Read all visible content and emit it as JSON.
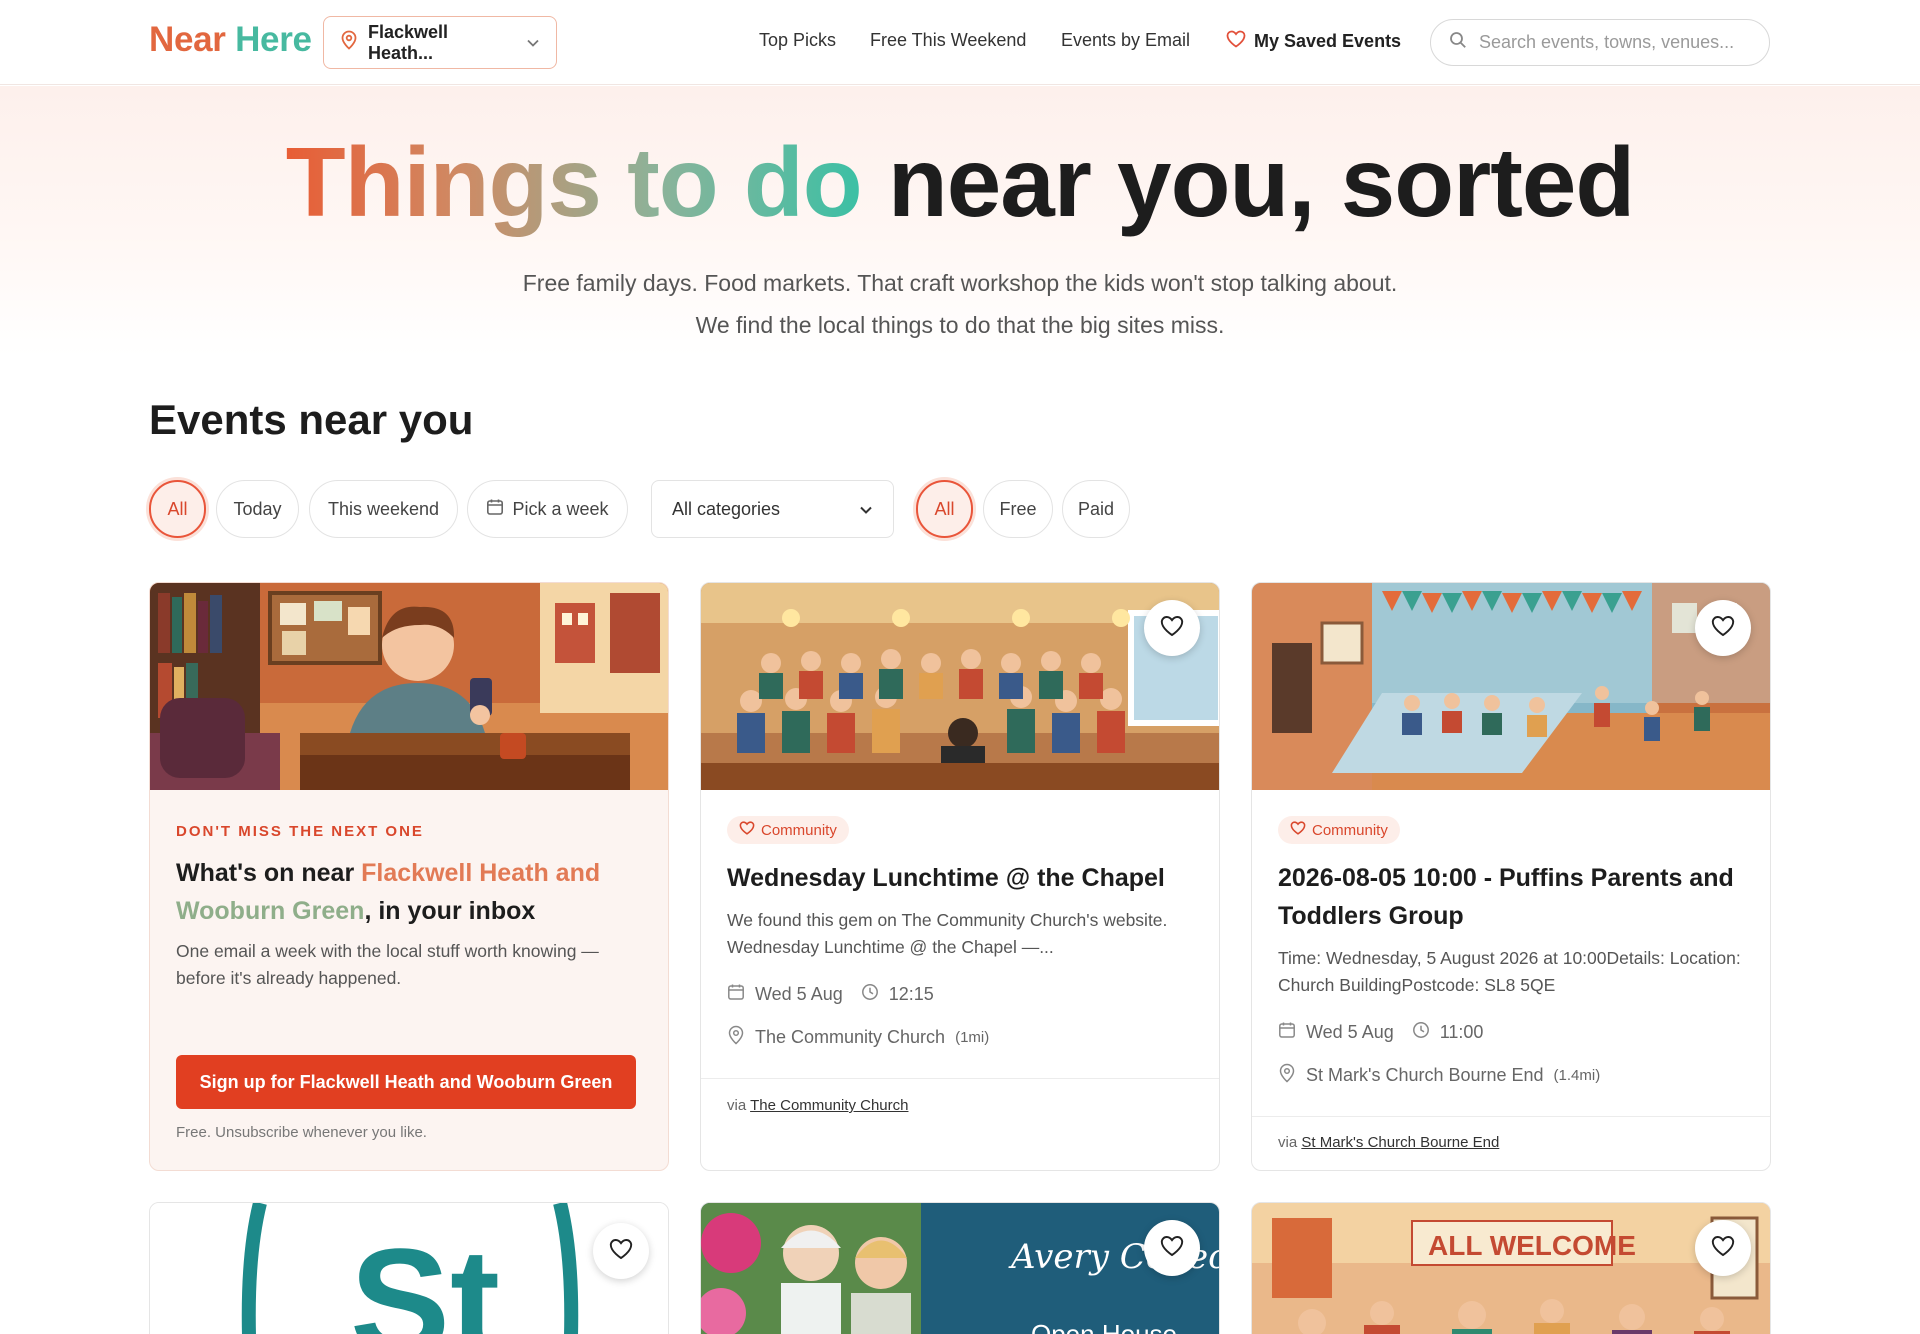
{
  "header": {
    "logo_near": "Near",
    "logo_here": "Here",
    "location": "Flackwell Heath...",
    "nav": {
      "top_picks": "Top Picks",
      "free_weekend": "Free This Weekend",
      "events_email": "Events by Email",
      "saved": "My Saved Events"
    },
    "search_placeholder": "Search events, towns, venues..."
  },
  "hero": {
    "title_gradient": "Things to do",
    "title_rest": "near you, sorted",
    "subtitle": "Free family days. Food markets. That craft workshop the kids won't stop talking about. We find the local things to do that the big sites miss."
  },
  "events": {
    "title": "Events near you",
    "date_filters": [
      "All",
      "Today",
      "This weekend",
      "Pick a week"
    ],
    "category_select": "All categories",
    "price_filters": [
      "All",
      "Free",
      "Paid"
    ]
  },
  "promo": {
    "kicker": "DON'T MISS THE NEXT ONE",
    "title_pre": "What's on near ",
    "title_place_a": "Flackwell Heath and",
    "title_place_b": "Wooburn Green",
    "title_post": ", in your inbox",
    "desc": "One email a week with the local stuff worth knowing — before it's already happened.",
    "button": "Sign up for Flackwell Heath and Wooburn Green",
    "note": "Free. Unsubscribe whenever you like."
  },
  "cards": [
    {
      "badge": "Community",
      "title": "Wednesday Lunchtime @ the Chapel",
      "desc": "We found this gem on The Community Church's website. Wednesday Lunchtime @ the Chapel —...",
      "date": "Wed 5 Aug",
      "time": "12:15",
      "venue": "The Community Church",
      "distance": "(1mi)",
      "via_label": "via",
      "via_link": "The Community Church"
    },
    {
      "badge": "Community",
      "title": "2026-08-05 10:00 - Puffins Parents and Toddlers Group",
      "desc": "Time: Wednesday, 5 August 2026 at 10:00Details: Location: Church BuildingPostcode: SL8 5QE",
      "date": "Wed 5 Aug",
      "time": "11:00",
      "venue": "St Mark's Church Bourne End",
      "distance": "(1.4mi)",
      "via_label": "via",
      "via_link": "St Mark's Church Bourne End"
    }
  ],
  "bottom_cards": {
    "card4_logo": "St",
    "card5_brand": "Avery Collection",
    "card5_text": "Open House",
    "card6_banner": "ALL WELCOME"
  },
  "colors": {
    "accent": "#e13f21",
    "brand_orange": "#e2673f",
    "brand_teal": "#47b9a0"
  }
}
